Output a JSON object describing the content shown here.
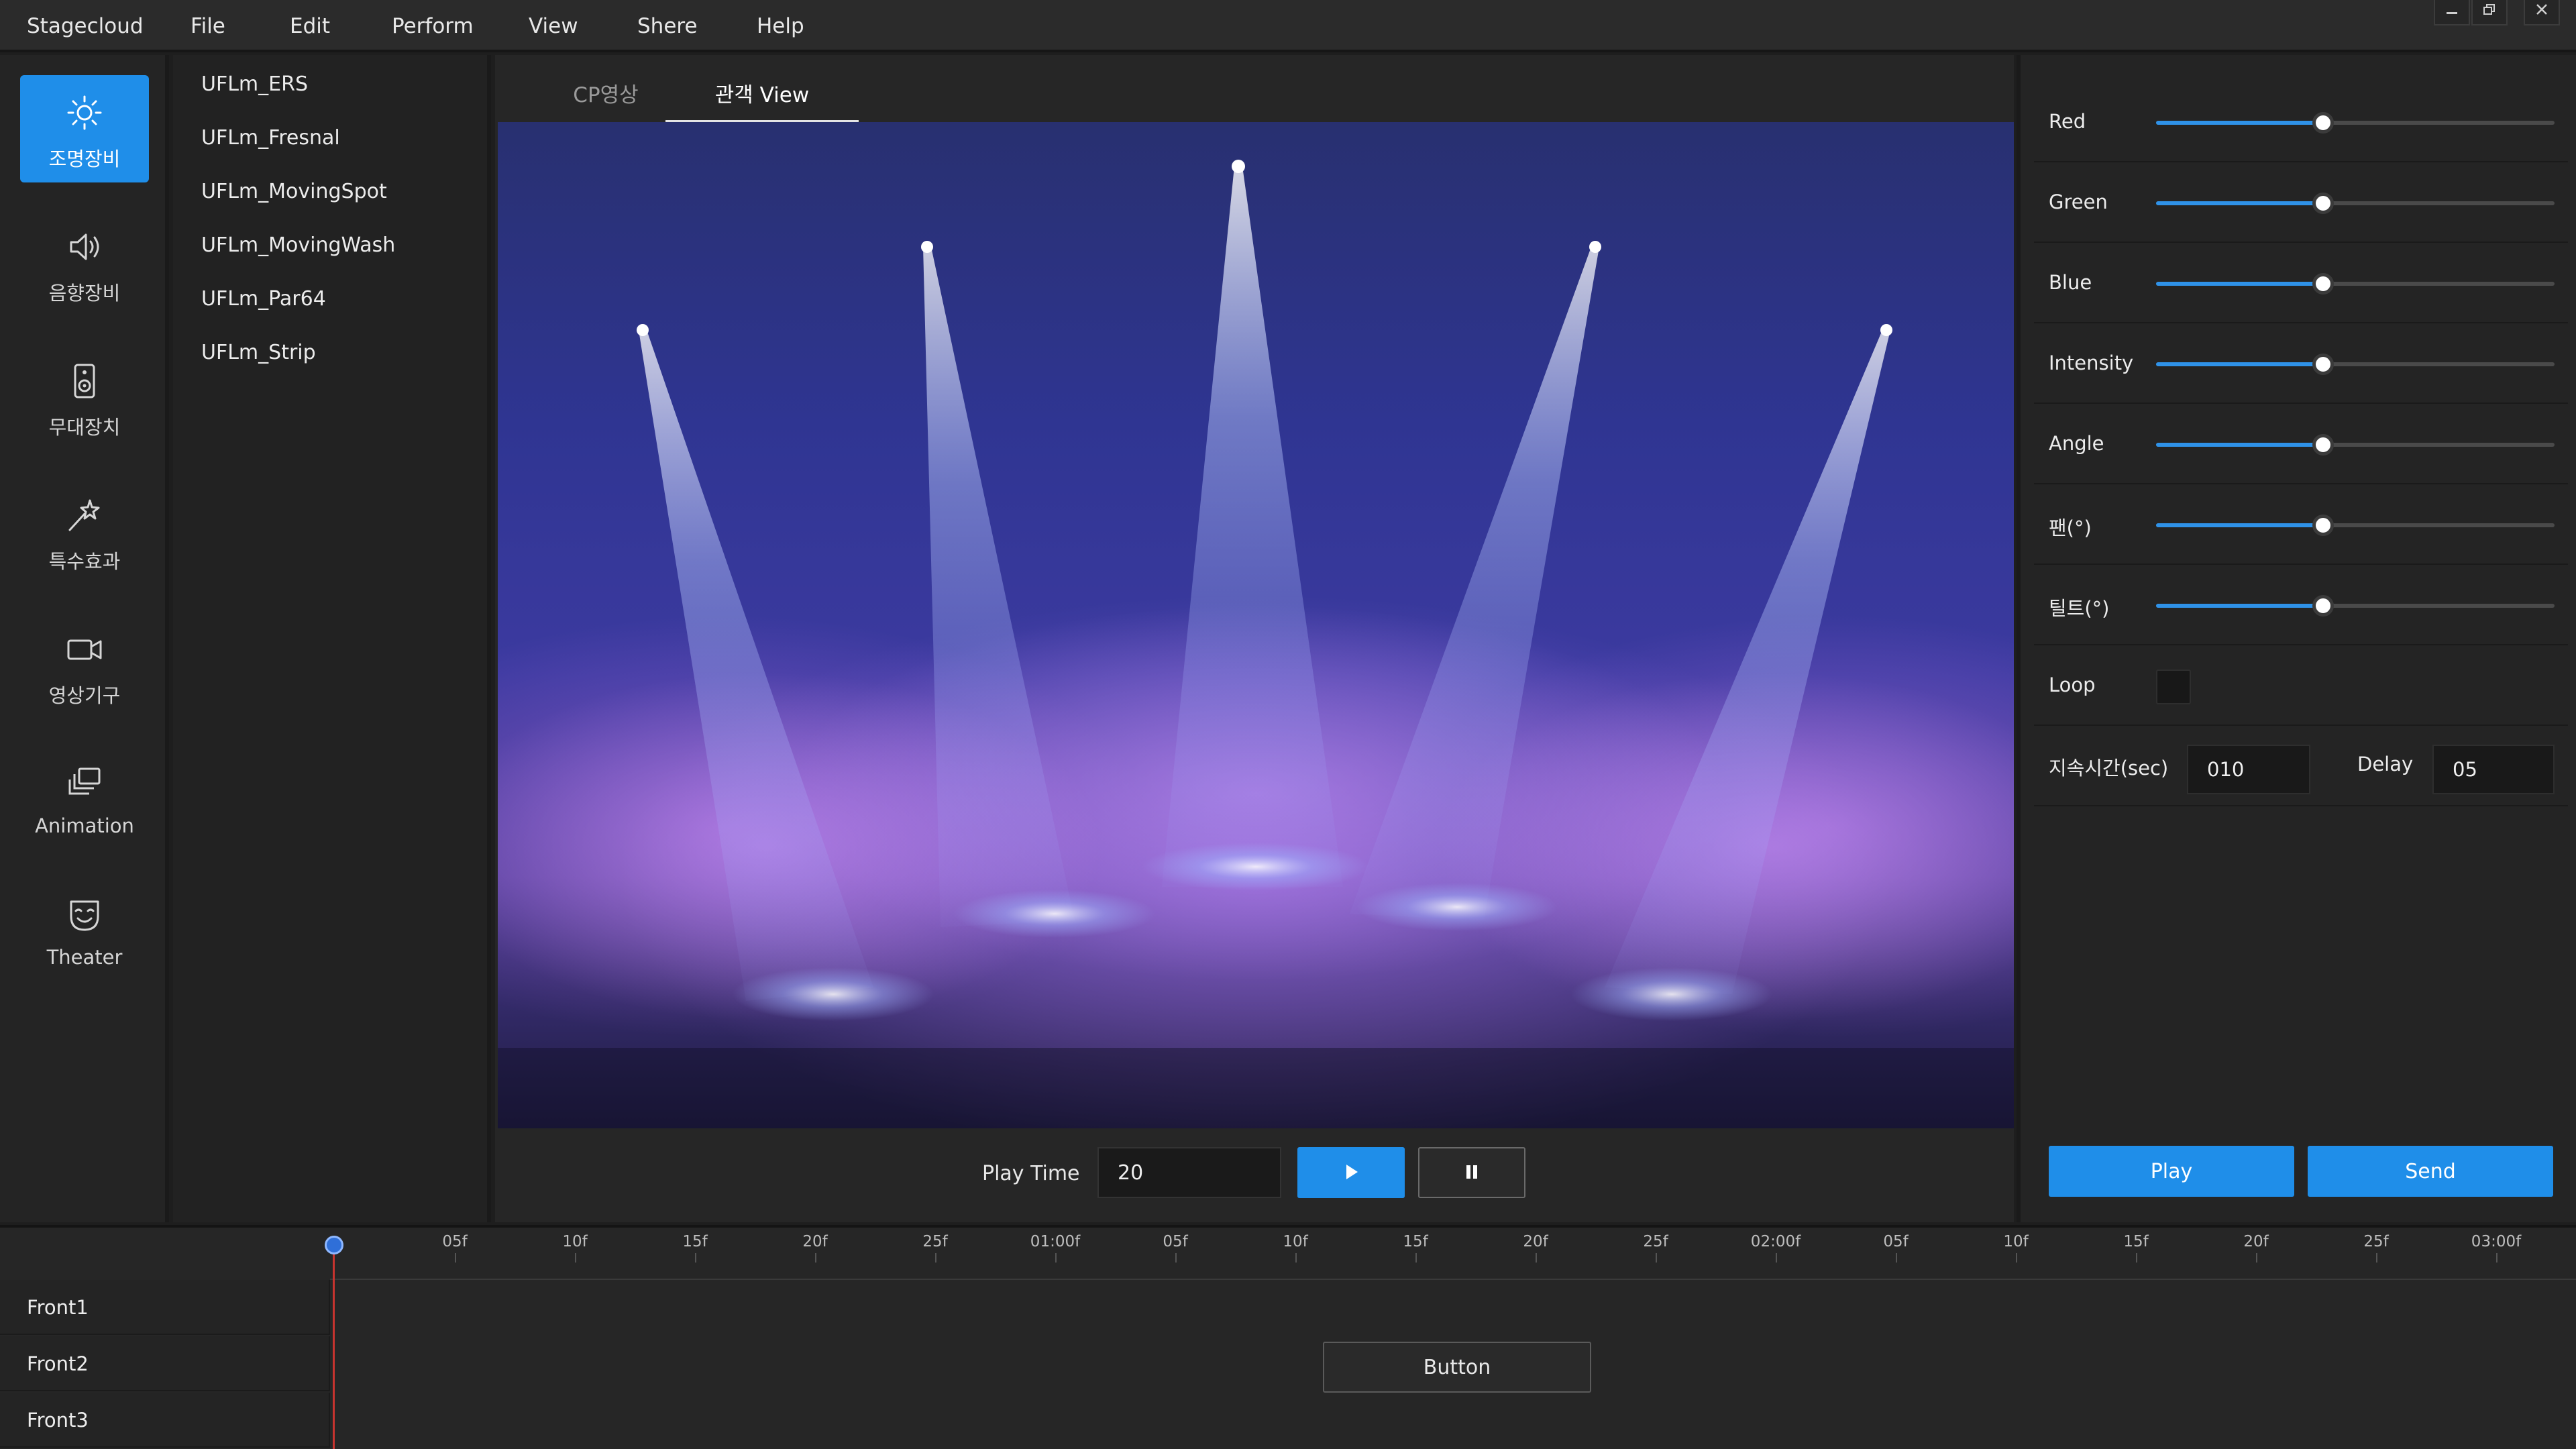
{
  "menubar": {
    "app_name": "Stagecloud",
    "items": [
      "File",
      "Edit",
      "Perform",
      "View",
      "Shere",
      "Help"
    ]
  },
  "sidebar": {
    "items": [
      {
        "label": "조명장비",
        "icon": "sun-icon",
        "active": true
      },
      {
        "label": "음향장비",
        "icon": "speaker-icon",
        "active": false
      },
      {
        "label": "무대장치",
        "icon": "loudspeaker-box-icon",
        "active": false
      },
      {
        "label": "특수효과",
        "icon": "magic-wand-icon",
        "active": false
      },
      {
        "label": "영상기구",
        "icon": "video-camera-icon",
        "active": false
      },
      {
        "label": "Animation",
        "icon": "layers-icon",
        "active": false
      },
      {
        "label": "Theater",
        "icon": "theater-mask-icon",
        "active": false
      }
    ]
  },
  "fixtures": [
    "UFLm_ERS",
    "UFLm_Fresnal",
    "UFLm_MovingSpot",
    "UFLm_MovingWash",
    "UFLm_Par64",
    "UFLm_Strip"
  ],
  "center": {
    "tabs": [
      {
        "label": "CP영상",
        "active": false
      },
      {
        "label": "관객 View",
        "active": true
      }
    ],
    "playbar": {
      "label": "Play Time",
      "value": "20"
    }
  },
  "props": {
    "sliders": [
      {
        "label": "Red",
        "value": 0.42
      },
      {
        "label": "Green",
        "value": 0.42
      },
      {
        "label": "Blue",
        "value": 0.42
      },
      {
        "label": "Intensity",
        "value": 0.42
      },
      {
        "label": "Angle",
        "value": 0.42
      },
      {
        "label": "팬(°)",
        "value": 0.42
      },
      {
        "label": "틸트(°)",
        "value": 0.42
      }
    ],
    "loop_label": "Loop",
    "duration_label": "지속시간(sec)",
    "duration_value": "010",
    "delay_label": "Delay",
    "delay_value": "05",
    "play_label": "Play",
    "send_label": "Send"
  },
  "timeline": {
    "ticks": [
      "05f",
      "10f",
      "15f",
      "20f",
      "25f",
      "01:00f",
      "05f",
      "10f",
      "15f",
      "20f",
      "25f",
      "02:00f",
      "05f",
      "10f",
      "15f",
      "20f",
      "25f",
      "03:00f"
    ],
    "tracks": [
      "Front1",
      "Front2",
      "Front3"
    ],
    "button_label": "Button"
  },
  "colors": {
    "accent": "#1f8ee9",
    "background": "#1e1e1e",
    "panel": "#242424"
  }
}
